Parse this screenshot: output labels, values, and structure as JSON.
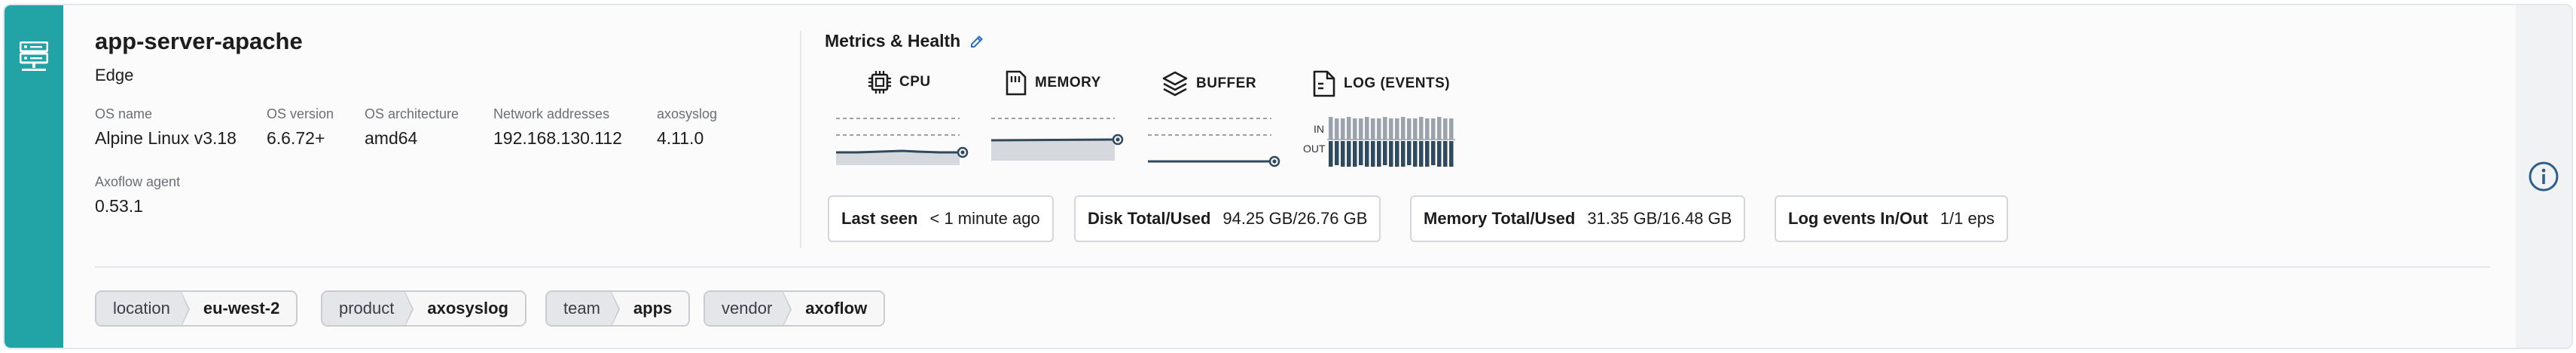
{
  "host": {
    "name": "app-server-apache",
    "type": "Edge",
    "fields": [
      {
        "label": "OS name",
        "value": "Alpine Linux v3.18"
      },
      {
        "label": "OS version",
        "value": "6.6.72+"
      },
      {
        "label": "OS architecture",
        "value": "amd64"
      },
      {
        "label": "Network addresses",
        "value": "192.168.130.112"
      },
      {
        "label": "axosyslog",
        "value": "4.11.0"
      },
      {
        "label": "Axoflow agent",
        "value": "0.53.1"
      }
    ]
  },
  "metrics": {
    "title": "Metrics & Health",
    "cpu_label": "CPU",
    "memory_label": "MEMORY",
    "buffer_label": "BUFFER",
    "log_label": "LOG (EVENTS)",
    "in_label": "IN",
    "out_label": "OUT"
  },
  "stats": {
    "last_seen": {
      "label": "Last seen",
      "value": "< 1 minute ago"
    },
    "disk": {
      "label": "Disk Total/Used",
      "value": "94.25 GB/26.76 GB"
    },
    "memory": {
      "label": "Memory Total/Used",
      "value": "31.35 GB/16.48 GB"
    },
    "log_events": {
      "label": "Log events In/Out",
      "value": "1/1 eps"
    }
  },
  "labels": [
    {
      "key": "location",
      "value": "eu-west-2"
    },
    {
      "key": "product",
      "value": "axosyslog"
    },
    {
      "key": "team",
      "value": "apps"
    },
    {
      "key": "vendor",
      "value": "axoflow"
    }
  ],
  "colors": {
    "accent": "#22a4a6",
    "graph_line": "#2f4a5e",
    "graph_fill": "#d5d9de",
    "info_icon": "#2c5f8a",
    "edit_icon": "#2c6ec5"
  },
  "icons": {
    "sidebar": "server-icon",
    "edit": "pencil-icon",
    "info": "info-icon",
    "cpu": "cpu-chip-icon",
    "memory": "memory-card-icon",
    "buffer": "layers-icon",
    "log": "document-icon"
  }
}
